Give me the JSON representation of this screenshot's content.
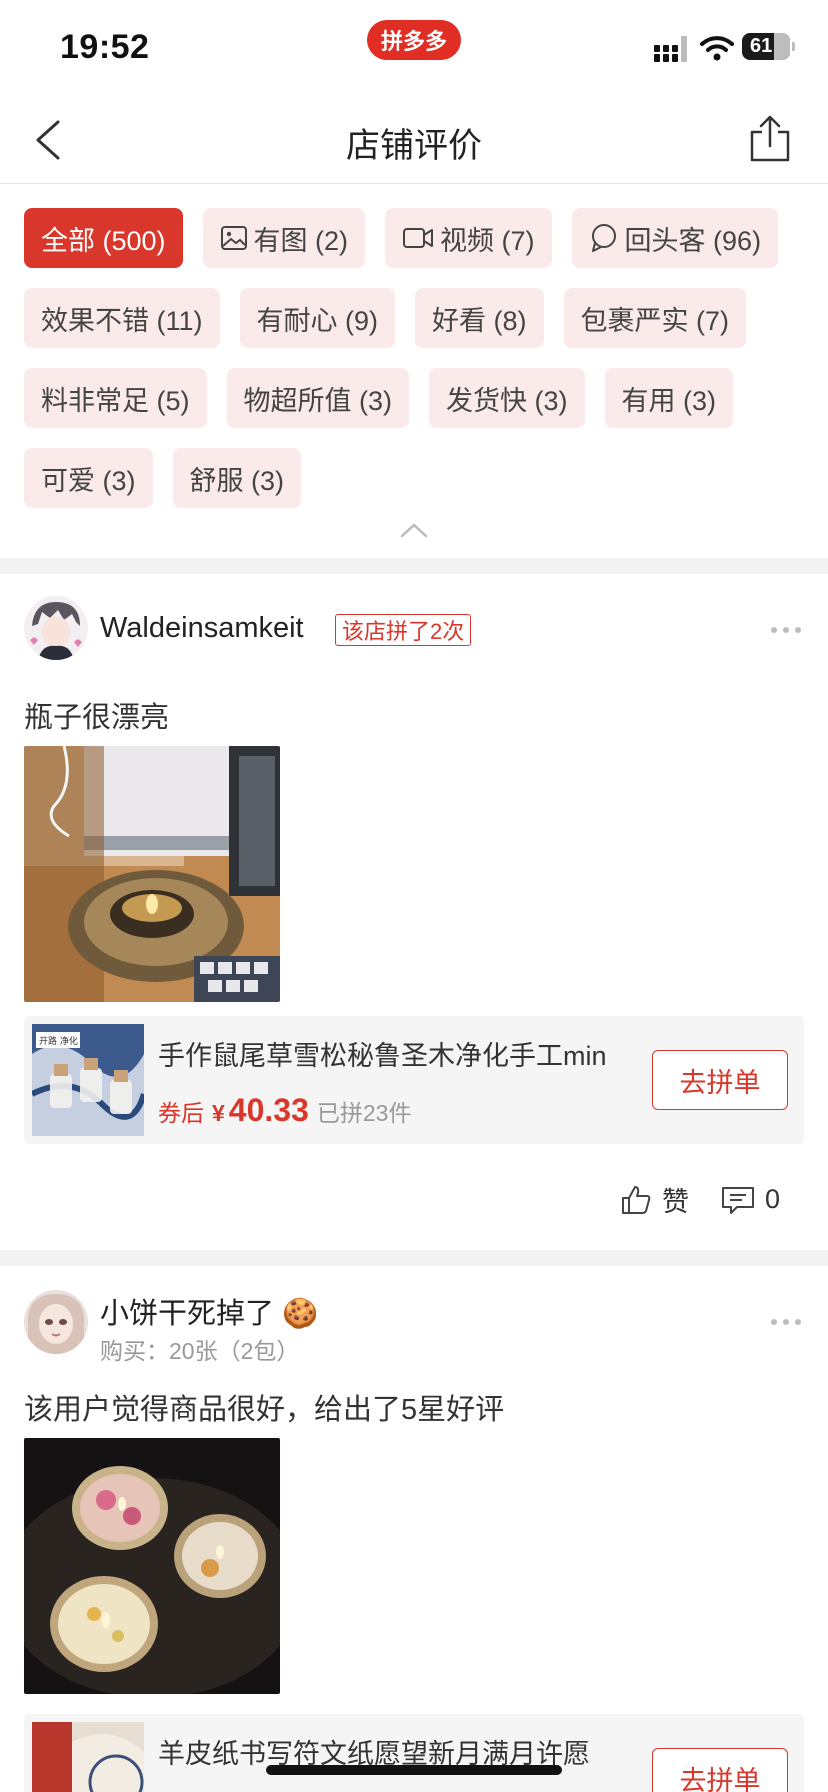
{
  "status_bar": {
    "time": "19:52",
    "app_badge": "拼多多",
    "battery": "61"
  },
  "nav": {
    "title": "店铺评价",
    "back_icon": "chevron-left-icon",
    "share_icon": "share-icon"
  },
  "filters": [
    {
      "label": "全部 (500)",
      "active": true
    },
    {
      "label": "有图 (2)",
      "icon": "image-icon"
    },
    {
      "label": "视频 (7)",
      "icon": "video-icon"
    },
    {
      "label": "回头客 (96)",
      "icon": "returning-customer-icon"
    },
    {
      "label": "效果不错 (11)"
    },
    {
      "label": "有耐心 (9)"
    },
    {
      "label": "好看 (8)"
    },
    {
      "label": "包裹严实 (7)"
    },
    {
      "label": "料非常足 (5)"
    },
    {
      "label": "物超所值 (3)"
    },
    {
      "label": "发货快 (3)"
    },
    {
      "label": "有用 (3)"
    },
    {
      "label": "可爱 (3)"
    },
    {
      "label": "舒服 (3)"
    }
  ],
  "reviews": [
    {
      "username": "Waldeinsamkeit",
      "badge": "该店拼了2次",
      "text": "瓶子很漂亮",
      "product": {
        "name": "手作鼠尾草雪松秘鲁圣木净化手工min",
        "coupon_label": "券后",
        "currency": "¥",
        "price": "40.33",
        "sold": "已拼23件",
        "button": "去拼单",
        "thumb_label": "开路 净化"
      },
      "like_label": "赞",
      "comment_count": "0"
    },
    {
      "username": "小饼干死掉了",
      "username_emoji": "🍪",
      "purchase_info": "购买：20张（2包）",
      "text": "该用户觉得商品很好，给出了5星好评",
      "product": {
        "name": "羊皮纸书写符文纸愿望新月满月许愿",
        "button": "去拼单"
      }
    }
  ],
  "colors": {
    "accent": "#d9372b",
    "chip_bg": "#fbeaea",
    "brand": "#e02e24"
  }
}
